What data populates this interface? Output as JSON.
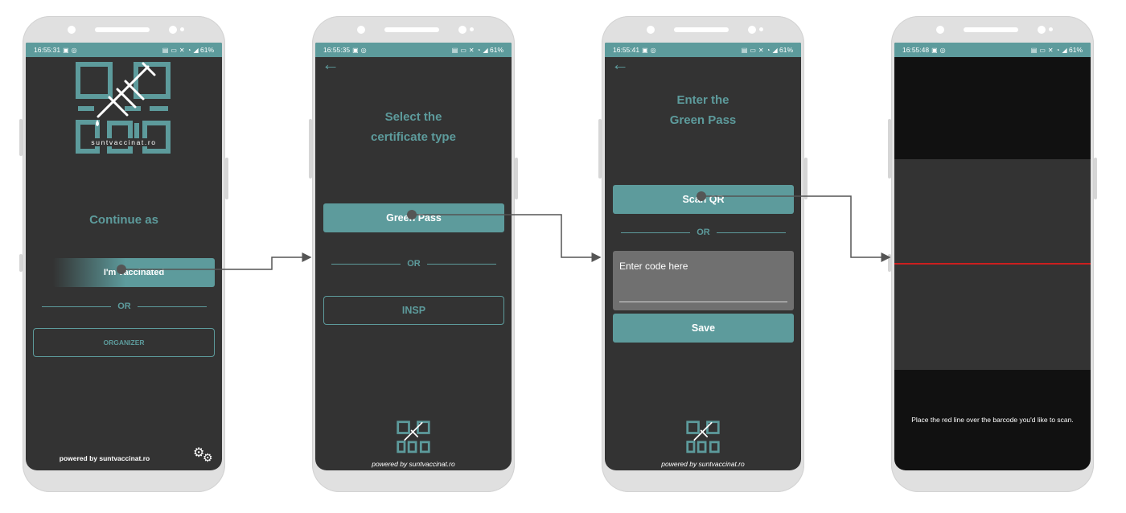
{
  "colors": {
    "accent": "#5d9b9c",
    "screen_bg": "#333333",
    "phone_frame": "#e0e0e0",
    "scan_line": "#cc1f1f"
  },
  "screens": [
    {
      "status": {
        "time": "16:55:31",
        "battery": "61%"
      },
      "logo_text": "suntvaccinat.ro",
      "continue_as": "Continue as",
      "primary_button": "I'm vaccinated",
      "or": "OR",
      "secondary_button": "ORGANIZER",
      "footer": "powered by suntvaccinat.ro",
      "settings_icon": "gears-icon"
    },
    {
      "status": {
        "time": "16:55:35",
        "battery": "61%"
      },
      "title_line1": "Select the",
      "title_line2": "certificate type",
      "primary_button": "Green Pass",
      "or": "OR",
      "secondary_button": "INSP",
      "footer": "powered by suntvaccinat.ro"
    },
    {
      "status": {
        "time": "16:55:41",
        "battery": "61%"
      },
      "title_line1": "Enter the",
      "title_line2": "Green Pass",
      "primary_button": "Scan QR",
      "or": "OR",
      "input_placeholder": "Enter code here",
      "save_button": "Save",
      "footer": "powered by suntvaccinat.ro"
    },
    {
      "status": {
        "time": "16:55:48",
        "battery": "61%"
      },
      "scan_hint": "Place the red line over the barcode you'd like to scan."
    }
  ]
}
